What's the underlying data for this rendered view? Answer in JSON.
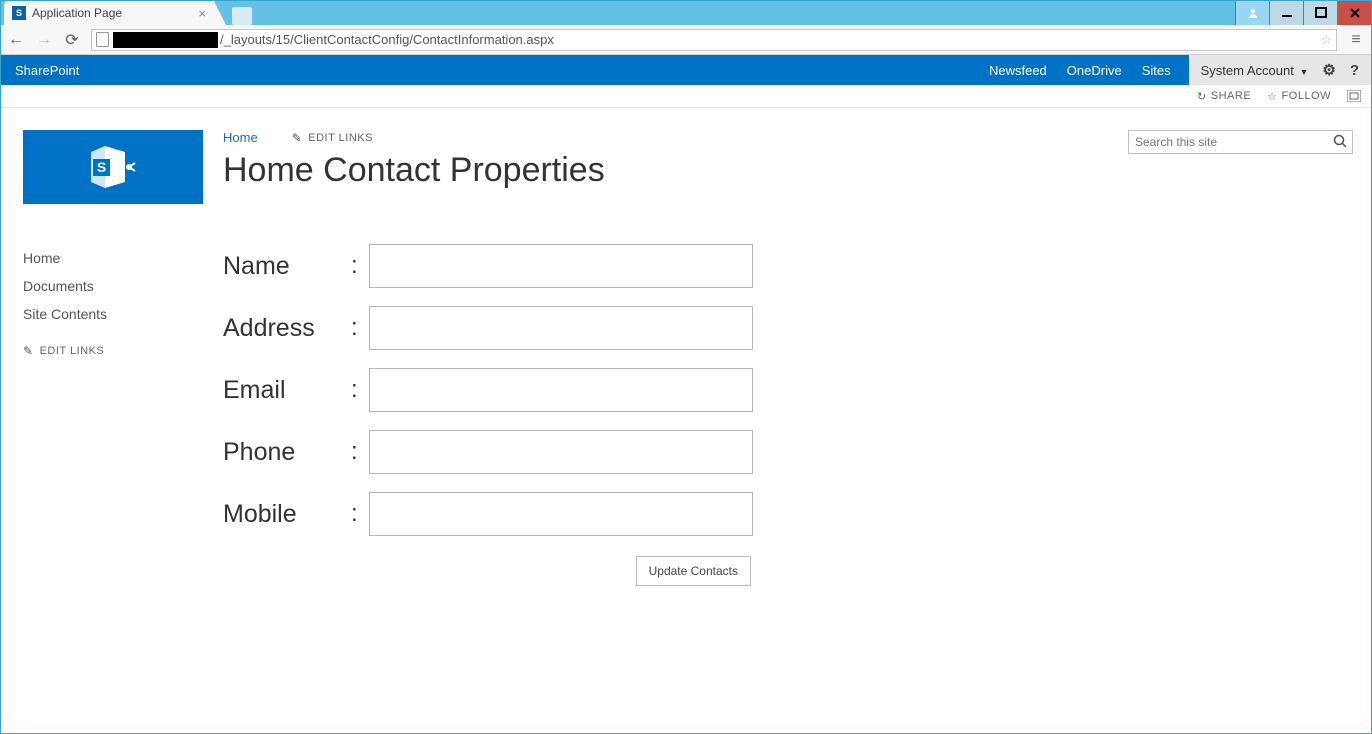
{
  "browser": {
    "tab_title": "Application Page",
    "url_visible": "/_layouts/15/ClientContactConfig/ContactInformation.aspx"
  },
  "suite": {
    "brand": "SharePoint",
    "links": [
      "Newsfeed",
      "OneDrive",
      "Sites"
    ],
    "account_label": "System Account"
  },
  "promoted": {
    "share": "SHARE",
    "follow": "FOLLOW"
  },
  "header": {
    "breadcrumb_home": "Home",
    "edit_links": "EDIT LINKS",
    "page_title": "Home Contact Properties"
  },
  "search": {
    "placeholder": "Search this site"
  },
  "left_nav": {
    "items": [
      "Home",
      "Documents",
      "Site Contents"
    ],
    "edit_links": "EDIT LINKS"
  },
  "form": {
    "fields": [
      {
        "label": "Name",
        "value": ""
      },
      {
        "label": "Address",
        "value": ""
      },
      {
        "label": "Email",
        "value": ""
      },
      {
        "label": "Phone",
        "value": ""
      },
      {
        "label": "Mobile",
        "value": ""
      }
    ],
    "submit_label": "Update Contacts"
  }
}
